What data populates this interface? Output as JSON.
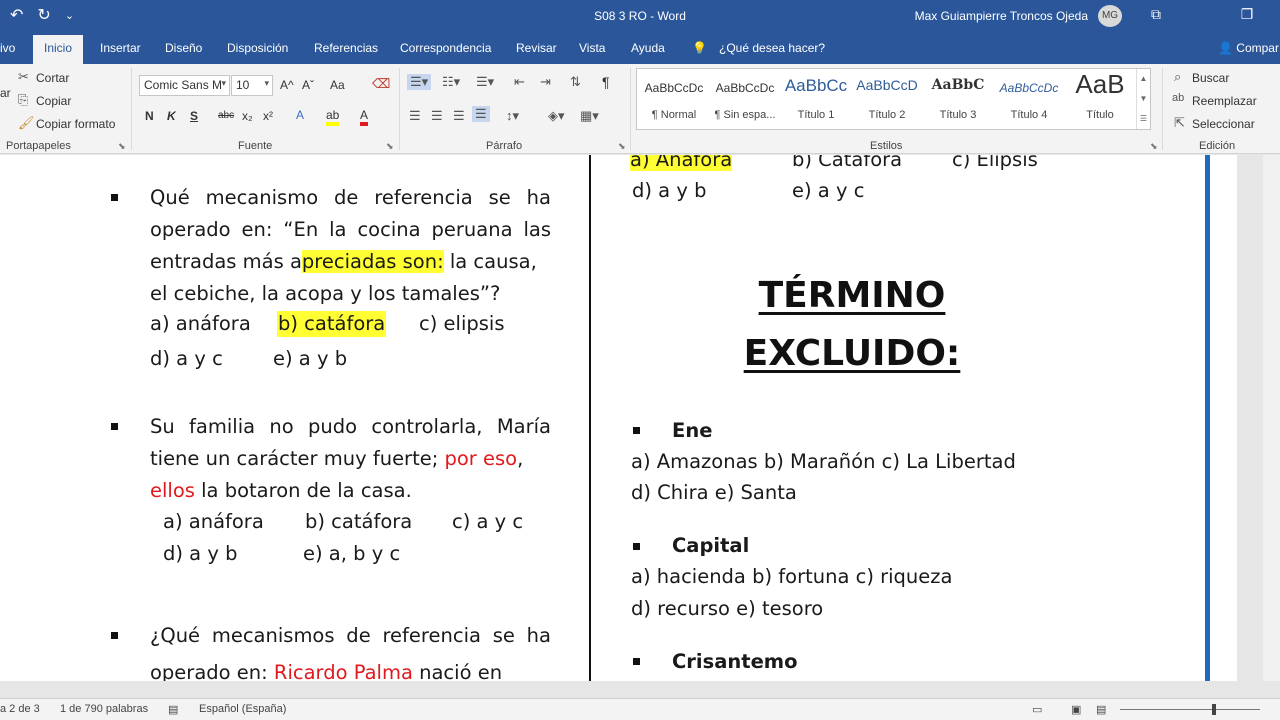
{
  "titlebar": {
    "title": "S08  3 RO  -  Word",
    "user": "Max Guiampierre Troncos Ojeda",
    "initials": "MG",
    "undo_icon": "↶",
    "redo_icon": "↻",
    "qat_more_icon": "⌄",
    "restore_icon": "⧉",
    "maximize_icon": "❐"
  },
  "tabs": {
    "file": "ivo",
    "home": "Inicio",
    "insert": "Insertar",
    "design": "Diseño",
    "layout": "Disposición",
    "references": "Referencias",
    "mailings": "Correspondencia",
    "review": "Revisar",
    "view": "Vista",
    "help": "Ayuda",
    "tell_me": "¿Qué desea hacer?",
    "share": "Compar"
  },
  "ribbon": {
    "clipboard": {
      "cut": "Cortar",
      "copy": "Copiar",
      "format_painter": "Copiar formato",
      "label": "Portapapeles",
      "paste_fragment": "ar"
    },
    "font": {
      "family": "Comic Sans M",
      "size": "10",
      "bold": "N",
      "italic": "K",
      "underline": "S",
      "strike": "abc",
      "sub": "x₂",
      "sup": "x²",
      "label": "Fuente",
      "grow": "A^",
      "shrink": "Aˇ",
      "case": "Aa",
      "effects": "A",
      "highlight": "ab",
      "color": "A"
    },
    "paragraph": {
      "label": "Párrafo",
      "pilcrow": "¶"
    },
    "styles": {
      "label": "Estilos",
      "items": [
        {
          "preview": "AaBbCcDc",
          "name": "¶ Normal"
        },
        {
          "preview": "AaBbCcDc",
          "name": "¶ Sin espa..."
        },
        {
          "preview": "AaBbCc",
          "name": "Título 1"
        },
        {
          "preview": "AaBbCcD",
          "name": "Título 2"
        },
        {
          "preview": "AaBbC",
          "name": "Título 3"
        },
        {
          "preview": "AaBbCcDc",
          "name": "Título 4"
        },
        {
          "preview": "AaB",
          "name": "Título"
        }
      ]
    },
    "editing": {
      "label": "Edición",
      "find": "Buscar",
      "replace": "Reemplazar",
      "select": "Seleccionar"
    }
  },
  "document": {
    "q1": {
      "line1": "Qué mecanismo de referencia se ha",
      "line2": "operado en: “En la cocina peruana las",
      "line3a": "entradas más a",
      "line3hl": "preciadas son:",
      "line3b": " la causa,",
      "line4": "el cebiche, la acopa y los tamales”?",
      "opt_a": "a) anáfora",
      "opt_b": "b) catáfora",
      "opt_c": "c) elipsis",
      "opt_d": "d) a y c",
      "opt_e": "e) a y b"
    },
    "q2": {
      "line1": "Su familia no pudo controlarla, María",
      "line2a": "tiene un carácter muy fuerte; ",
      "line2red": "por eso",
      "line2b": ",",
      "line3red": "ellos",
      "line3b": " la botaron de la casa.",
      "opt_a": "a) anáfora",
      "opt_b": "b) catáfora",
      "opt_c": "c) a y c",
      "opt_d": "d) a y b",
      "opt_e": "e) a, b y c"
    },
    "q3": {
      "line1": "¿Qué mecanismos de referencia se ha",
      "line2a": "operado en: ",
      "line2red": "Ricardo Palma",
      "line2b": " nació en"
    },
    "right_top": {
      "opt_a": "a) Anáfora",
      "opt_b": "b) Catáfora",
      "opt_c": "c) Elipsis",
      "opt_d": "d) a y b",
      "opt_e": "e) a y c"
    },
    "heading1": "TÉRMINO",
    "heading2": "EXCLUIDO:",
    "items": [
      {
        "word": "Ene",
        "line1": "a) Amazonas b) Marañón    c) La Libertad",
        "line2": "d) Chira        e) Santa"
      },
      {
        "word": "Capital",
        "line1": "a) hacienda    b) fortuna       c) riqueza",
        "line2": "d) recurso     e) tesoro"
      },
      {
        "word": "Crisantemo"
      }
    ]
  },
  "status": {
    "page": "a 2 de 3",
    "words": "1 de 790 palabras",
    "language": "Español (España)"
  }
}
